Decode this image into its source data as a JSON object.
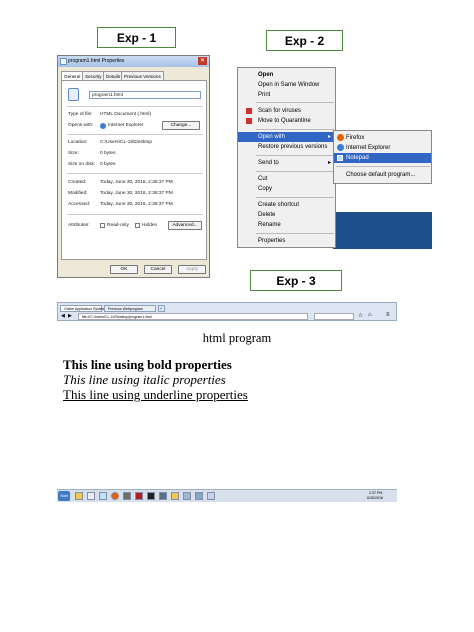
{
  "exp_labels": [
    "Exp - 1",
    "Exp - 2",
    "Exp - 3"
  ],
  "dialog": {
    "title": "program1.html Properties",
    "tabs": [
      "General",
      "Security",
      "Details",
      "Previous Versions"
    ],
    "file_name": "program1.html",
    "rows": [
      {
        "label": "Type of file:",
        "value": "HTML Document (.html)"
      },
      {
        "label": "Opens with:",
        "value": "Internet Explorer"
      },
      {
        "label": "Location:",
        "value": "C:\\Users\\CL-19\\Desktop"
      },
      {
        "label": "Size:",
        "value": "0 bytes"
      },
      {
        "label": "Size on disk:",
        "value": "0 bytes"
      },
      {
        "label": "Created:",
        "value": "Today, June 30, 2016, 2:36:37 PM"
      },
      {
        "label": "Modified:",
        "value": "Today, June 30, 2016, 2:36:37 PM"
      },
      {
        "label": "Accessed:",
        "value": "Today, June 30, 2016, 2:36:37 PM"
      }
    ],
    "change_label": "Change...",
    "attributes_label": "Attributes:",
    "readonly_label": "Read-only",
    "hidden_label": "Hidden",
    "advanced_label": "Advanced...",
    "ok_label": "OK",
    "cancel_label": "Cancel",
    "apply_label": "Apply"
  },
  "context_menu": {
    "items": [
      "Open",
      "Open in Same Window",
      "Print",
      "Scan for viruses",
      "Move to Quarantine",
      "Open with",
      "Restore previous versions",
      "Send to",
      "Cut",
      "Copy",
      "Create shortcut",
      "Delete",
      "Rename",
      "Properties"
    ],
    "submenu": [
      "Firefox",
      "Internet Explorer",
      "Notepad",
      "Choose default program..."
    ]
  },
  "browser": {
    "tabs": [
      "Online Application System",
      "Previous Webprogram"
    ],
    "address": "file:///C:/Users/CL-19/Desktop/program1.html"
  },
  "page": {
    "title": "html program",
    "bold_line": "This line using bold properties",
    "italic_line": "This line using italic properties",
    "underline_line": "This line using underline properties"
  },
  "taskbar": {
    "start_label": "Start",
    "clock_time": "2:37 PM",
    "clock_date": "6/30/2016"
  },
  "colors": {
    "highlight": "#3166c5",
    "label_border": "#4a8a3a"
  }
}
